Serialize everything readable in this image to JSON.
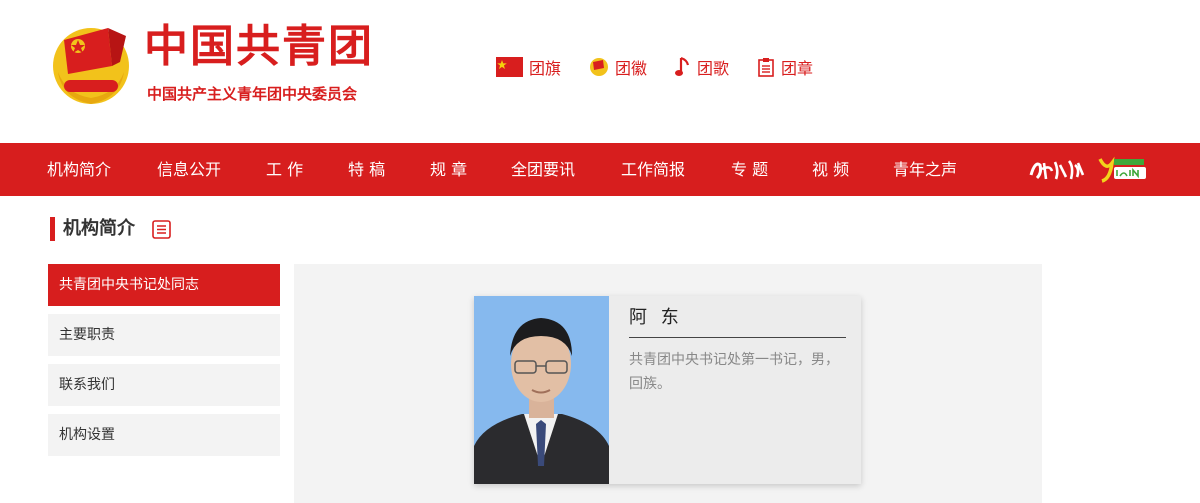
{
  "header": {
    "title": "中国共青团",
    "subtitle": "中国共产主义青年团中央委员会",
    "symbol_links": [
      {
        "label": "团旗",
        "icon": "flag-icon"
      },
      {
        "label": "团徽",
        "icon": "emblem-icon"
      },
      {
        "label": "团歌",
        "icon": "music-note-icon"
      },
      {
        "label": "团章",
        "icon": "document-icon"
      }
    ]
  },
  "nav": {
    "items": [
      "机构简介",
      "信息公开",
      "工 作",
      "特 稿",
      "规 章",
      "全团要讯",
      "工作简报",
      "专 题",
      "视 频",
      "青年之声"
    ]
  },
  "section": {
    "title": "机构简介"
  },
  "sidebar": {
    "items": [
      "共青团中央书记处同志",
      "主要职责",
      "联系我们",
      "机构设置"
    ]
  },
  "profile": {
    "name": "阿 东",
    "description": "共青团中央书记处第一书记，男，回族。"
  },
  "colors": {
    "brand_red": "#d71e1e",
    "panel_gray": "#f3f3f3",
    "photo_bg": "#86b9ee"
  }
}
